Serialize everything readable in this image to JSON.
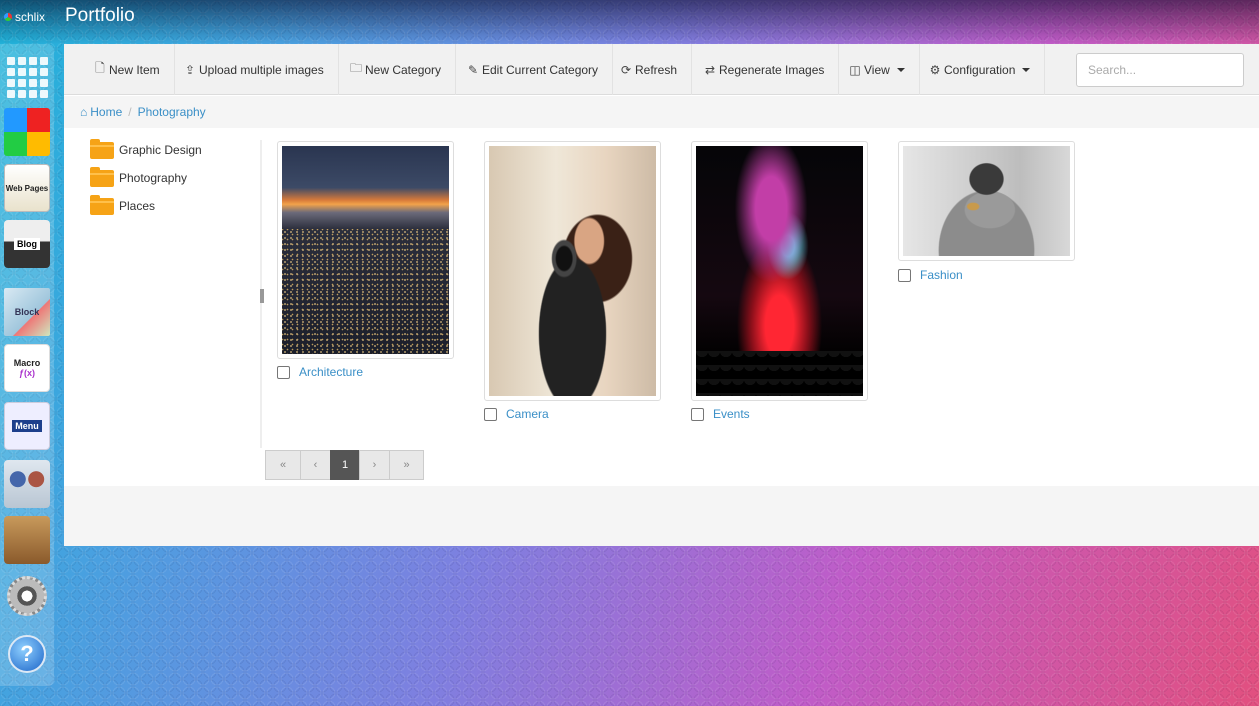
{
  "brand": {
    "name": "schlix"
  },
  "app": {
    "title": "Portfolio"
  },
  "dock": {
    "items": [
      {
        "name": "apps-grid-icon"
      },
      {
        "name": "color-blocks-icon"
      },
      {
        "name": "web-pages-icon",
        "label": "Web Pages"
      },
      {
        "name": "blog-icon",
        "label": "Blog"
      },
      {
        "name": "block-icon",
        "label": "Block"
      },
      {
        "name": "macro-icon",
        "label": "Macro"
      },
      {
        "name": "menu-icon",
        "label": "Menu"
      },
      {
        "name": "people-icon"
      },
      {
        "name": "toolbox-icon"
      },
      {
        "name": "settings-gear-icon"
      },
      {
        "name": "help-icon",
        "label": "?"
      }
    ]
  },
  "toolbar": {
    "new_item": "New Item",
    "upload_multiple": "Upload multiple images",
    "new_category": "New Category",
    "edit_category": "Edit Current Category",
    "refresh": "Refresh",
    "regenerate": "Regenerate Images",
    "view": "View",
    "configuration": "Configuration"
  },
  "search": {
    "placeholder": "Search...",
    "value": ""
  },
  "breadcrumb": {
    "home": "Home",
    "current": "Photography"
  },
  "folders": [
    "Graphic Design",
    "Photography",
    "Places"
  ],
  "items": [
    {
      "label": "Architecture",
      "checked": false
    },
    {
      "label": "Camera",
      "checked": false
    },
    {
      "label": "Events",
      "checked": false
    },
    {
      "label": "Fashion",
      "checked": false
    }
  ],
  "pagination": {
    "first": "«",
    "prev": "‹",
    "current": "1",
    "next": "›",
    "last": "»"
  },
  "colors": {
    "link": "#3a8fc7",
    "folder": "#f6a316",
    "toolbar_bg": "#f1f1f1",
    "active_page": "#555555"
  }
}
